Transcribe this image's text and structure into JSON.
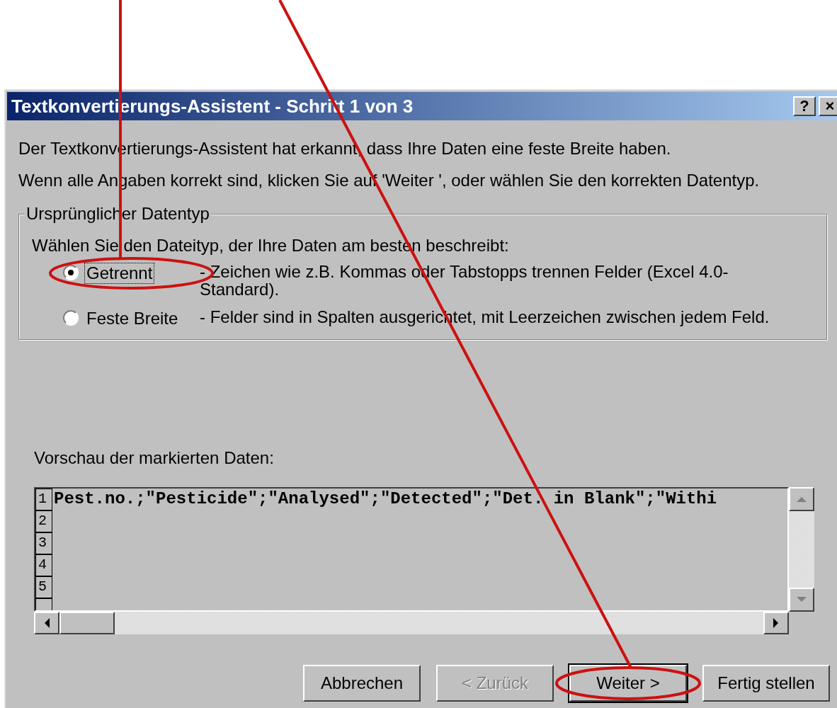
{
  "window": {
    "title": "Textkonvertierungs-Assistent - Schritt 1 von 3",
    "controls": [
      "?",
      "×"
    ]
  },
  "intro": [
    "Der Textkonvertierungs-Assistent hat erkannt, dass Ihre Daten eine feste Breite haben.",
    "Wenn alle Angaben korrekt sind, klicken Sie auf 'Weiter ', oder wählen Sie den korrekten Datentyp."
  ],
  "group": {
    "legend": "Ursprünglicher Datentyp",
    "prompt": "Wählen Sie den Dateityp, der Ihre Daten am besten beschreibt:",
    "options": [
      {
        "label": "Getrennt",
        "description": "- Zeichen wie z.B. Kommas oder Tabstopps trennen Felder (Excel 4.0-Standard).",
        "selected": true,
        "highlighted": true
      },
      {
        "label": "Feste Breite",
        "description": "- Felder sind in Spalten ausgerichtet, mit Leerzeichen zwischen jedem Feld.",
        "selected": false,
        "highlighted": false
      }
    ]
  },
  "preview": {
    "label": "Vorschau der markierten Daten:",
    "rows": [
      {
        "number": "1",
        "text": "Pest.no.;\"Pesticide\";\"Analysed\";\"Detected\";\"Det. in Blank\";\"Withi"
      },
      {
        "number": "2"
      },
      {
        "number": "3"
      },
      {
        "number": "4"
      },
      {
        "number": "5"
      }
    ]
  },
  "buttons": [
    {
      "label": "Abbrechen",
      "disabled": false,
      "default": false,
      "highlighted": false
    },
    {
      "label": "< Zurück",
      "disabled": true,
      "default": false,
      "highlighted": false
    },
    {
      "label": "Weiter >",
      "disabled": false,
      "default": true,
      "highlighted": true
    },
    {
      "label": "Fertig stellen",
      "disabled": false,
      "default": false,
      "highlighted": false
    }
  ]
}
